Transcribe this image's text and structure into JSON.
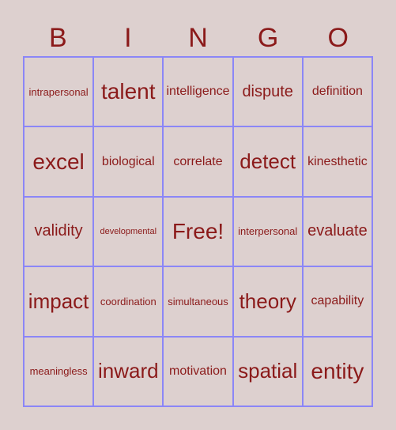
{
  "header": [
    "B",
    "I",
    "N",
    "G",
    "O"
  ],
  "cells": [
    [
      "intrapersonal",
      "talent",
      "intelligence",
      "dispute",
      "definition"
    ],
    [
      "excel",
      "biological",
      "correlate",
      "detect",
      "kinesthetic"
    ],
    [
      "validity",
      "developmental",
      "Free!",
      "interpersonal",
      "evaluate"
    ],
    [
      "impact",
      "coordination",
      "simultaneous",
      "theory",
      "capability"
    ],
    [
      "meaningless",
      "inward",
      "motivation",
      "spatial",
      "entity"
    ]
  ]
}
